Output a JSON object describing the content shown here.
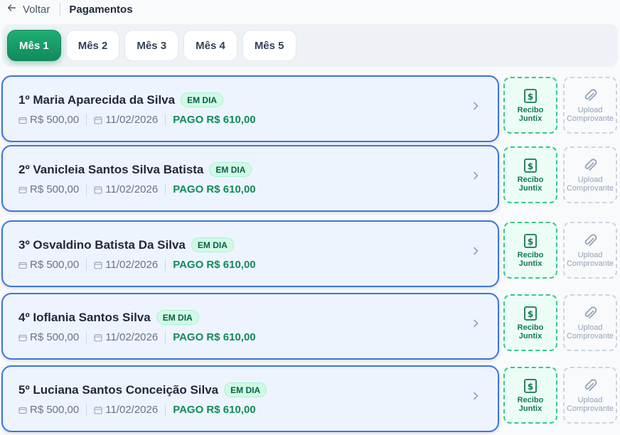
{
  "header": {
    "back_label": "Voltar",
    "title": "Pagamentos"
  },
  "tabs": [
    {
      "label": "Mês 1",
      "active": true
    },
    {
      "label": "Mês 2",
      "active": false
    },
    {
      "label": "Mês 3",
      "active": false
    },
    {
      "label": "Mês 4",
      "active": false
    },
    {
      "label": "Mês 5",
      "active": false
    }
  ],
  "payments": [
    {
      "name": "1º Maria Aparecida da Silva",
      "status": "EM DIA",
      "amount": "R$ 500,00",
      "date": "11/02/2026",
      "paid": "PAGO R$ 610,00"
    },
    {
      "name": "2º Vanicleia Santos Silva Batista",
      "status": "EM DIA",
      "amount": "R$ 500,00",
      "date": "11/02/2026",
      "paid": "PAGO R$ 610,00"
    },
    {
      "name": "3º Osvaldino Batista Da Silva",
      "status": "EM DIA",
      "amount": "R$ 500,00",
      "date": "11/02/2026",
      "paid": "PAGO R$ 610,00"
    },
    {
      "name": "4º Ioflania Santos Silva",
      "status": "EM DIA",
      "amount": "R$ 500,00",
      "date": "11/02/2026",
      "paid": "PAGO R$ 610,00"
    },
    {
      "name": "5º Luciana Santos Conceição Silva",
      "status": "EM DIA",
      "amount": "R$ 500,00",
      "date": "11/02/2026",
      "paid": "PAGO R$ 610,00"
    }
  ],
  "actions": {
    "recibo_line1": "Recibo",
    "recibo_line2": "Juntix",
    "upload_line1": "Upload",
    "upload_line2": "Comprovante"
  },
  "icons": {
    "back": "arrow-left-icon",
    "amount": "wallet-icon",
    "date": "calendar-icon",
    "open": "chevron-right-icon",
    "recibo": "dollar-receipt-icon",
    "upload": "paperclip-icon"
  },
  "colors": {
    "accent": "#128a5c",
    "card_border": "#3b74e0",
    "card_bg": "#eef4fe",
    "badge_bg": "#d1fae5",
    "paid_text": "#0f8a5a"
  }
}
